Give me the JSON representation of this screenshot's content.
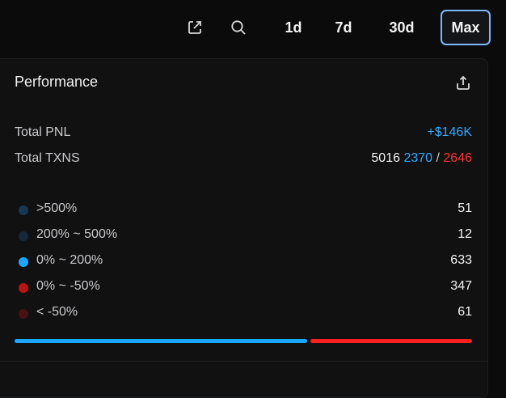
{
  "toolbar": {
    "ranges": [
      "1d",
      "7d",
      "30d",
      "Max"
    ],
    "active_range": "Max",
    "accent_color": "#7db8ff",
    "icons": [
      "external-link-icon",
      "search-icon"
    ]
  },
  "performance": {
    "title": "Performance",
    "share_icon": "share-icon",
    "total_pnl_label": "Total PNL",
    "total_pnl_value": "+$146K",
    "total_txns_label": "Total TXNS",
    "total_txns_value": "5016",
    "txns_buys": "2370",
    "txns_separator": "/",
    "txns_sells": "2646",
    "colors": {
      "positive": "#2fa8ff",
      "negative": "#ff3131"
    }
  },
  "distribution": [
    {
      "label": ">500%",
      "count": "51",
      "color": "#183852"
    },
    {
      "label": "200% ~ 500%",
      "count": "12",
      "color": "#15293a"
    },
    {
      "label": "0% ~ 200%",
      "count": "633",
      "color": "#1aa7ff"
    },
    {
      "label": "0% ~ -50%",
      "count": "347",
      "color": "#b81414"
    },
    {
      "label": "< -50%",
      "count": "61",
      "color": "#4a1111"
    }
  ],
  "ratio_bar": {
    "buy_fraction": 0.6444,
    "sell_fraction": 0.3556,
    "buy_color": "#1aa7ff",
    "sell_color": "#ff1f1f"
  }
}
